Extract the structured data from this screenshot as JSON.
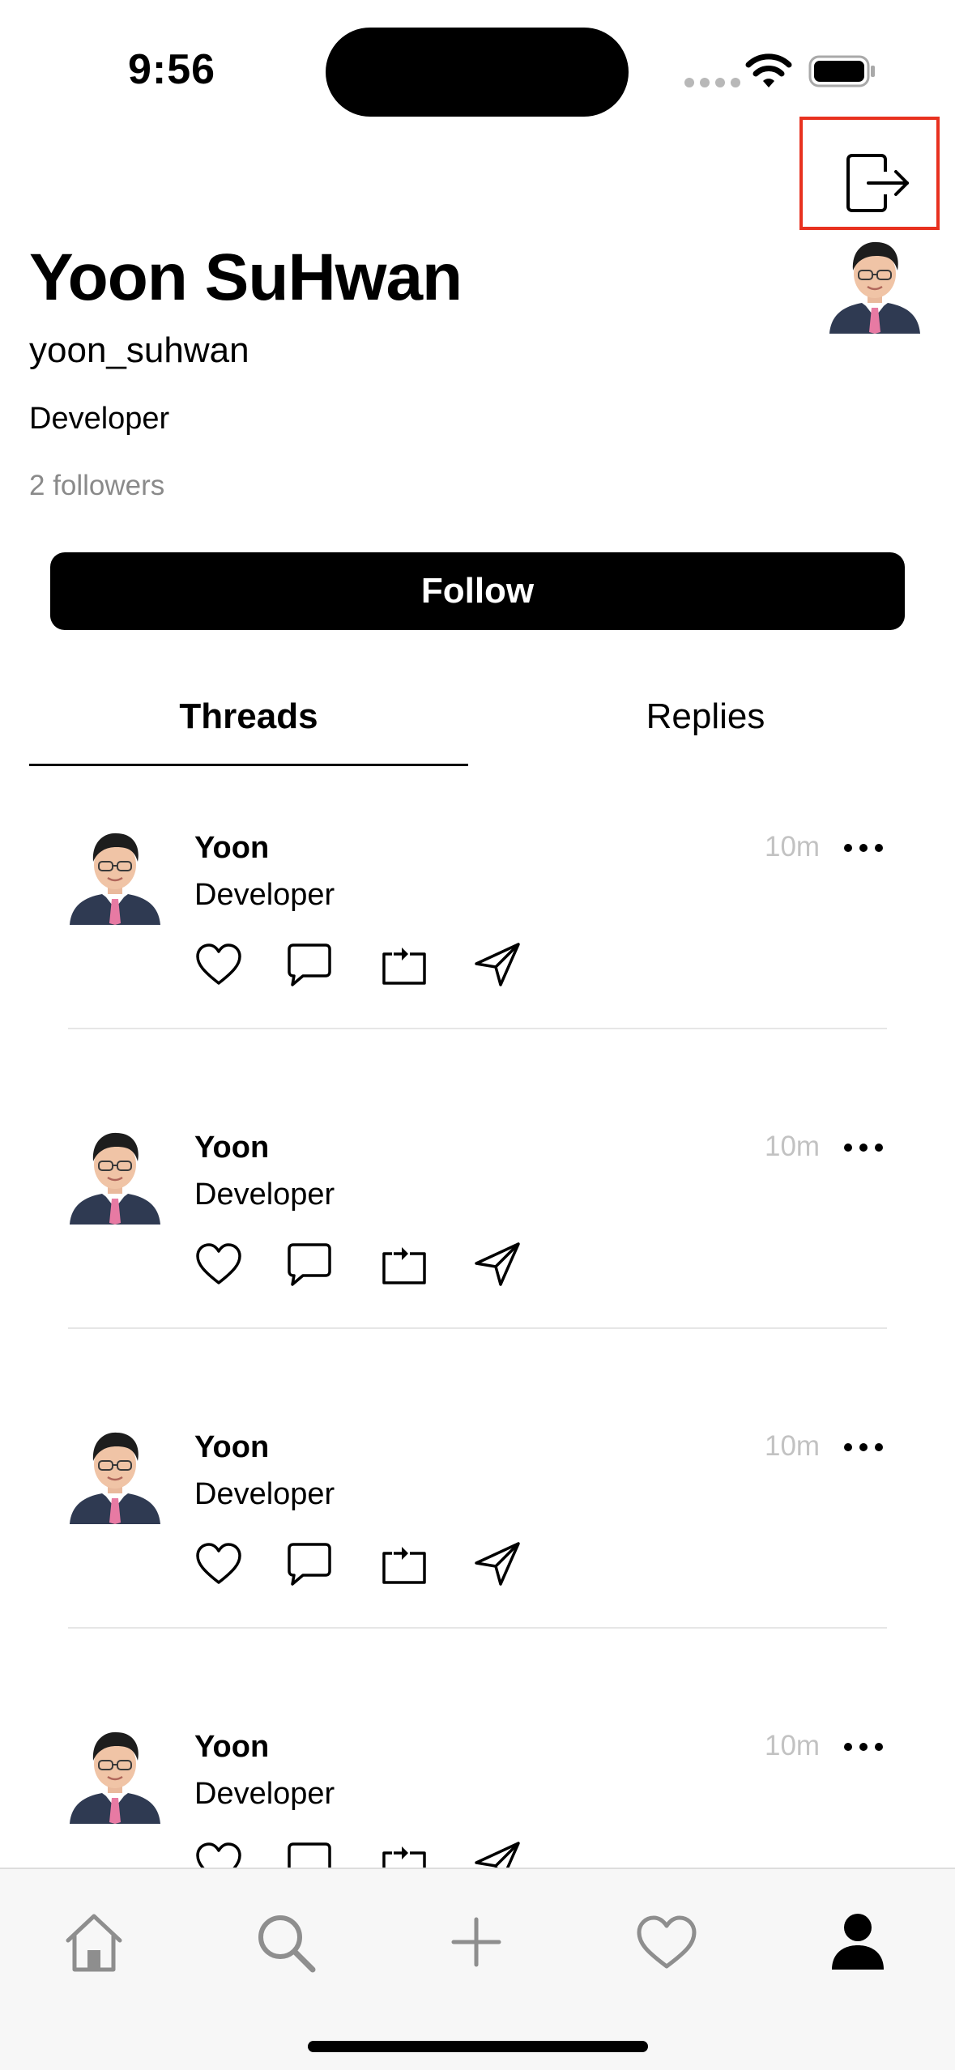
{
  "status_bar": {
    "time": "9:56",
    "icons": [
      "signal-dots-icon",
      "wifi-icon",
      "battery-icon"
    ]
  },
  "header": {
    "action_icon": "logout-icon"
  },
  "profile": {
    "name": "Yoon SuHwan",
    "handle": "yoon_suhwan",
    "bio": "Developer",
    "followers": "2 followers",
    "follow_label": "Follow"
  },
  "tabs": [
    {
      "label": "Threads",
      "selected": true
    },
    {
      "label": "Replies",
      "selected": false
    }
  ],
  "threads": [
    {
      "author": "Yoon",
      "text": "Developer",
      "time": "10m"
    },
    {
      "author": "Yoon",
      "text": "Developer",
      "time": "10m"
    },
    {
      "author": "Yoon",
      "text": "Developer",
      "time": "10m"
    },
    {
      "author": "Yoon",
      "text": "Developer",
      "time": "10m"
    }
  ],
  "tab_bar": {
    "items": [
      "home-icon",
      "search-icon",
      "compose-icon",
      "activity-icon",
      "profile-icon"
    ],
    "selected": "profile-icon"
  },
  "colors": {
    "highlight": "#e8311f",
    "primary": "#000000",
    "muted": "#8a8a8a",
    "time_text": "#c2c2c2",
    "divider": "#e6e6e6",
    "tab_bar_bg": "#f7f7f7",
    "inactive_icon": "#8e8e8e"
  }
}
